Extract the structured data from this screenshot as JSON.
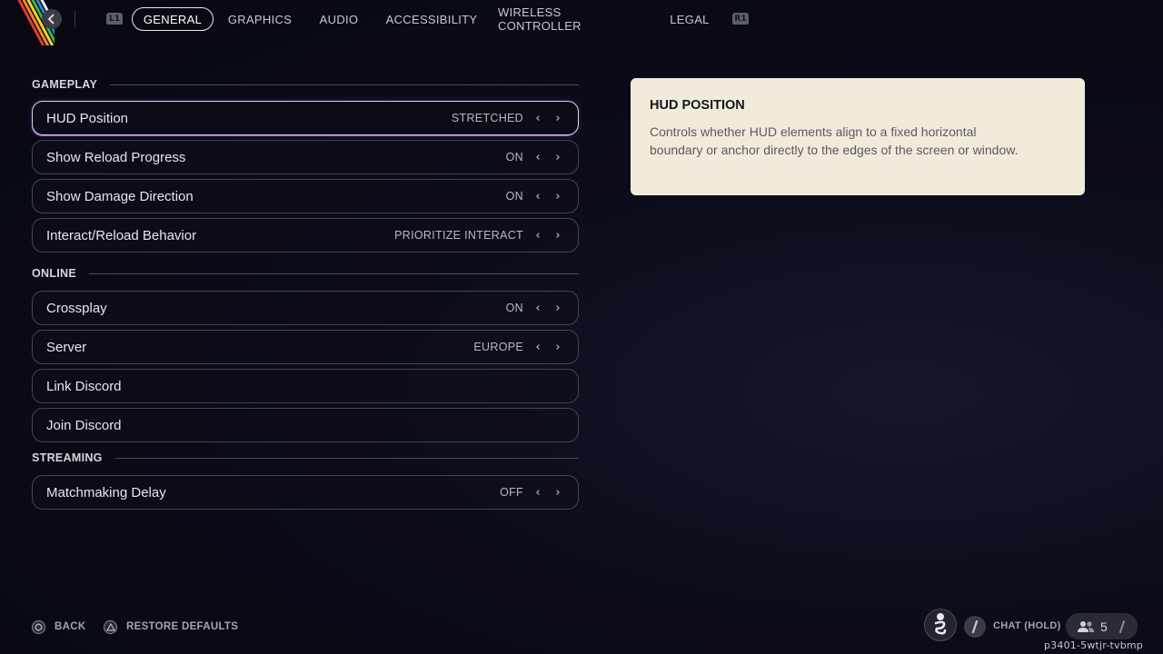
{
  "nav": {
    "back_icon": "chevron-left-icon",
    "left_bumper": "L1",
    "right_bumper": "R1",
    "tabs": [
      {
        "label": "GENERAL",
        "active": true
      },
      {
        "label": "GRAPHICS",
        "active": false
      },
      {
        "label": "AUDIO",
        "active": false
      },
      {
        "label": "ACCESSIBILITY",
        "active": false
      },
      {
        "label": "WIRELESS CONTROLLER",
        "active": false
      },
      {
        "label": "LEGAL",
        "active": false
      }
    ]
  },
  "sections": {
    "gameplay": "GAMEPLAY",
    "online": "ONLINE",
    "streaming": "STREAMING"
  },
  "settings": [
    {
      "label": "HUD Position",
      "value": "STRETCHED",
      "selected": true
    },
    {
      "label": "Show Reload Progress",
      "value": "ON"
    },
    {
      "label": "Show Damage Direction",
      "value": "ON"
    },
    {
      "label": "Interact/Reload Behavior",
      "value": "PRIORITIZE INTERACT"
    },
    {
      "label": "Crossplay",
      "value": "ON"
    },
    {
      "label": "Server",
      "value": "EUROPE"
    },
    {
      "label": "Link Discord",
      "value": ""
    },
    {
      "label": "Join Discord",
      "value": ""
    },
    {
      "label": "Matchmaking Delay",
      "value": "OFF"
    }
  ],
  "info_panel": {
    "title": "HUD POSITION",
    "body": "Controls whether HUD elements align to a fixed horizontal boundary or anchor directly to the edges of the screen or window."
  },
  "footer": {
    "back_label": "BACK",
    "restore_label": "RESTORE DEFAULTS",
    "chat_label": "CHAT (HOLD)",
    "party_count": "5",
    "build_id": "p3401-5wtjr-tvbmp"
  },
  "colors": {
    "accent": "#9a4fd0",
    "panel": "#f1ebdc",
    "background": "#0b0c18"
  }
}
